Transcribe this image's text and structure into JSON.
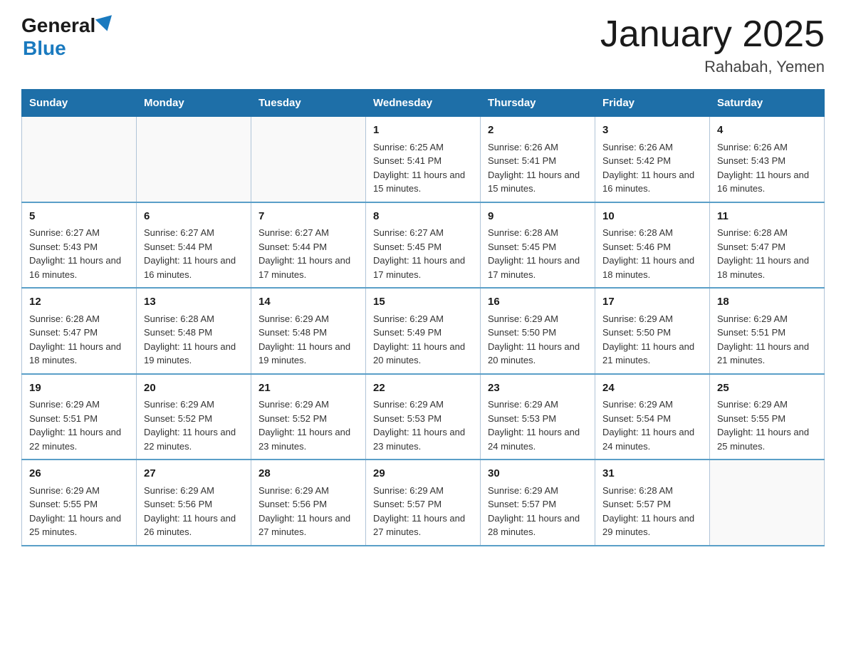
{
  "header": {
    "logo_general": "General",
    "logo_blue": "Blue",
    "title": "January 2025",
    "subtitle": "Rahabah, Yemen"
  },
  "days_of_week": [
    "Sunday",
    "Monday",
    "Tuesday",
    "Wednesday",
    "Thursday",
    "Friday",
    "Saturday"
  ],
  "weeks": [
    [
      {
        "day": "",
        "info": ""
      },
      {
        "day": "",
        "info": ""
      },
      {
        "day": "",
        "info": ""
      },
      {
        "day": "1",
        "info": "Sunrise: 6:25 AM\nSunset: 5:41 PM\nDaylight: 11 hours and 15 minutes."
      },
      {
        "day": "2",
        "info": "Sunrise: 6:26 AM\nSunset: 5:41 PM\nDaylight: 11 hours and 15 minutes."
      },
      {
        "day": "3",
        "info": "Sunrise: 6:26 AM\nSunset: 5:42 PM\nDaylight: 11 hours and 16 minutes."
      },
      {
        "day": "4",
        "info": "Sunrise: 6:26 AM\nSunset: 5:43 PM\nDaylight: 11 hours and 16 minutes."
      }
    ],
    [
      {
        "day": "5",
        "info": "Sunrise: 6:27 AM\nSunset: 5:43 PM\nDaylight: 11 hours and 16 minutes."
      },
      {
        "day": "6",
        "info": "Sunrise: 6:27 AM\nSunset: 5:44 PM\nDaylight: 11 hours and 16 minutes."
      },
      {
        "day": "7",
        "info": "Sunrise: 6:27 AM\nSunset: 5:44 PM\nDaylight: 11 hours and 17 minutes."
      },
      {
        "day": "8",
        "info": "Sunrise: 6:27 AM\nSunset: 5:45 PM\nDaylight: 11 hours and 17 minutes."
      },
      {
        "day": "9",
        "info": "Sunrise: 6:28 AM\nSunset: 5:45 PM\nDaylight: 11 hours and 17 minutes."
      },
      {
        "day": "10",
        "info": "Sunrise: 6:28 AM\nSunset: 5:46 PM\nDaylight: 11 hours and 18 minutes."
      },
      {
        "day": "11",
        "info": "Sunrise: 6:28 AM\nSunset: 5:47 PM\nDaylight: 11 hours and 18 minutes."
      }
    ],
    [
      {
        "day": "12",
        "info": "Sunrise: 6:28 AM\nSunset: 5:47 PM\nDaylight: 11 hours and 18 minutes."
      },
      {
        "day": "13",
        "info": "Sunrise: 6:28 AM\nSunset: 5:48 PM\nDaylight: 11 hours and 19 minutes."
      },
      {
        "day": "14",
        "info": "Sunrise: 6:29 AM\nSunset: 5:48 PM\nDaylight: 11 hours and 19 minutes."
      },
      {
        "day": "15",
        "info": "Sunrise: 6:29 AM\nSunset: 5:49 PM\nDaylight: 11 hours and 20 minutes."
      },
      {
        "day": "16",
        "info": "Sunrise: 6:29 AM\nSunset: 5:50 PM\nDaylight: 11 hours and 20 minutes."
      },
      {
        "day": "17",
        "info": "Sunrise: 6:29 AM\nSunset: 5:50 PM\nDaylight: 11 hours and 21 minutes."
      },
      {
        "day": "18",
        "info": "Sunrise: 6:29 AM\nSunset: 5:51 PM\nDaylight: 11 hours and 21 minutes."
      }
    ],
    [
      {
        "day": "19",
        "info": "Sunrise: 6:29 AM\nSunset: 5:51 PM\nDaylight: 11 hours and 22 minutes."
      },
      {
        "day": "20",
        "info": "Sunrise: 6:29 AM\nSunset: 5:52 PM\nDaylight: 11 hours and 22 minutes."
      },
      {
        "day": "21",
        "info": "Sunrise: 6:29 AM\nSunset: 5:52 PM\nDaylight: 11 hours and 23 minutes."
      },
      {
        "day": "22",
        "info": "Sunrise: 6:29 AM\nSunset: 5:53 PM\nDaylight: 11 hours and 23 minutes."
      },
      {
        "day": "23",
        "info": "Sunrise: 6:29 AM\nSunset: 5:53 PM\nDaylight: 11 hours and 24 minutes."
      },
      {
        "day": "24",
        "info": "Sunrise: 6:29 AM\nSunset: 5:54 PM\nDaylight: 11 hours and 24 minutes."
      },
      {
        "day": "25",
        "info": "Sunrise: 6:29 AM\nSunset: 5:55 PM\nDaylight: 11 hours and 25 minutes."
      }
    ],
    [
      {
        "day": "26",
        "info": "Sunrise: 6:29 AM\nSunset: 5:55 PM\nDaylight: 11 hours and 25 minutes."
      },
      {
        "day": "27",
        "info": "Sunrise: 6:29 AM\nSunset: 5:56 PM\nDaylight: 11 hours and 26 minutes."
      },
      {
        "day": "28",
        "info": "Sunrise: 6:29 AM\nSunset: 5:56 PM\nDaylight: 11 hours and 27 minutes."
      },
      {
        "day": "29",
        "info": "Sunrise: 6:29 AM\nSunset: 5:57 PM\nDaylight: 11 hours and 27 minutes."
      },
      {
        "day": "30",
        "info": "Sunrise: 6:29 AM\nSunset: 5:57 PM\nDaylight: 11 hours and 28 minutes."
      },
      {
        "day": "31",
        "info": "Sunrise: 6:28 AM\nSunset: 5:57 PM\nDaylight: 11 hours and 29 minutes."
      },
      {
        "day": "",
        "info": ""
      }
    ]
  ]
}
